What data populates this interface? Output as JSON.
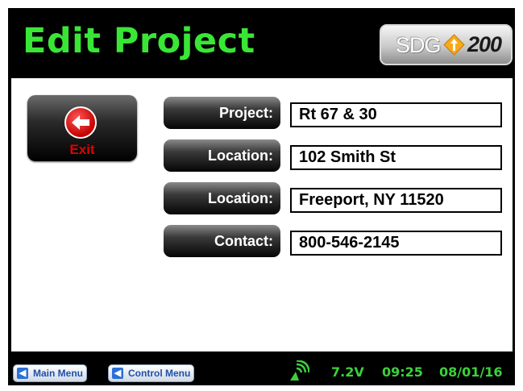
{
  "header": {
    "title": "Edit Project",
    "logo": {
      "brand_text": "SDG",
      "model_text": "200",
      "diamond_colors": [
        "#f7a81b",
        "#ffffff"
      ]
    }
  },
  "exit_button": {
    "label": "Exit",
    "icon": "arrow-left-icon"
  },
  "fields": [
    {
      "label": "Project:",
      "value": "Rt 67 & 30"
    },
    {
      "label": "Location:",
      "value": "102 Smith St"
    },
    {
      "label": "Location:",
      "value": "Freeport, NY 11520"
    },
    {
      "label": "Contact:",
      "value": "800-546-2145"
    }
  ],
  "footer": {
    "main_menu_label": "Main Menu",
    "control_menu_label": "Control Menu",
    "signal_icon": "satellite-signal-icon",
    "voltage": "7.2V",
    "time": "09:25",
    "date": "08/01/16"
  },
  "colors": {
    "title_green": "#39e636",
    "status_green": "#3ad13a",
    "exit_red": "#e00000",
    "menu_blue": "#1f4fa8"
  }
}
